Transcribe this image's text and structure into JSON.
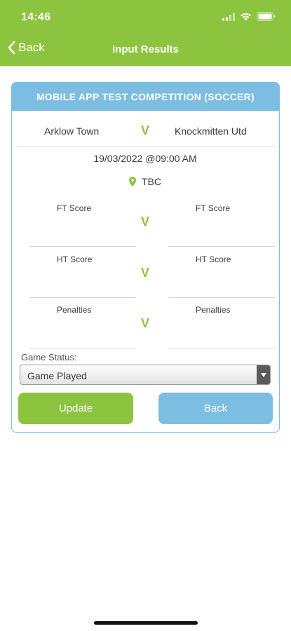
{
  "status_bar": {
    "time": "14:46",
    "icons": [
      "signal-icon",
      "wifi-icon",
      "battery-icon"
    ]
  },
  "nav": {
    "back_label": "Back",
    "title": "Input Results"
  },
  "card": {
    "competition": "MOBILE APP TEST COMPETITION (SOCCER)",
    "home_team": "Arklow Town",
    "away_team": "Knockmitten Utd",
    "versus": "V",
    "datetime": "19/03/2022 @09:00 AM",
    "venue": "TBC",
    "score_rows": [
      {
        "home_label": "FT Score",
        "away_label": "FT Score",
        "versus": "V"
      },
      {
        "home_label": "HT Score",
        "away_label": "HT Score",
        "versus": "V"
      },
      {
        "home_label": "Penalties",
        "away_label": "Penalties",
        "versus": "V"
      }
    ],
    "game_status_label": "Game Status:",
    "game_status_value": "Game Played",
    "update_label": "Update",
    "back_label": "Back"
  },
  "colors": {
    "brand_green": "#8cc43f",
    "brand_blue": "#7cbde2"
  }
}
